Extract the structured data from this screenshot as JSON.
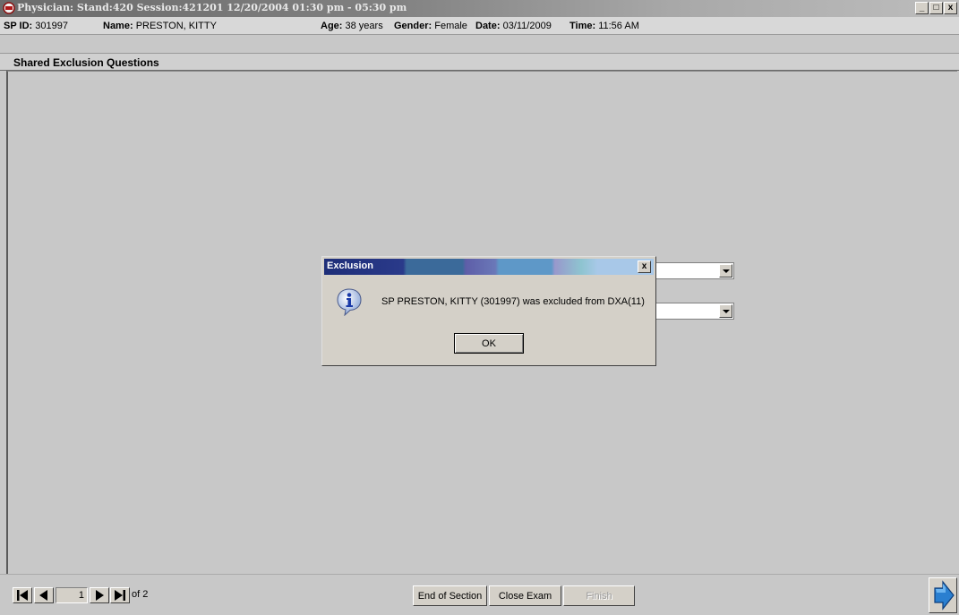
{
  "window": {
    "title": "Physician: Stand:420 Session:421201 12/20/2004 01:30 pm - 05:30 pm",
    "controls": {
      "minimize": "_",
      "maximize": "□",
      "close": "x"
    }
  },
  "patient": {
    "sp_id_label": "SP ID:",
    "sp_id": "301997",
    "name_label": "Name:",
    "name": "PRESTON, KITTY",
    "age_label": "Age:",
    "age": "38 years",
    "gender_label": "Gender:",
    "gender": "Female",
    "date_label": "Date:",
    "date": "03/11/2009",
    "time_label": "Time:",
    "time": "11:56 AM"
  },
  "section": {
    "title": "Shared Exclusion Questions"
  },
  "dialog": {
    "title": "Exclusion",
    "close": "x",
    "icon": "info-icon",
    "message": "SP PRESTON, KITTY  (301997) was excluded from DXA(11)",
    "ok_label": "OK"
  },
  "navigation": {
    "current_page": "1",
    "of_label": "of 2",
    "end_of_section_label": "End of Section",
    "close_exam_label": "Close Exam",
    "finish_label": "Finish"
  },
  "colors": {
    "background": "#c8c8c8",
    "dialog_title_dark": "#1e2e78",
    "dialog_title_light": "#a8c8e8",
    "next_arrow": "#2a7fd0"
  }
}
